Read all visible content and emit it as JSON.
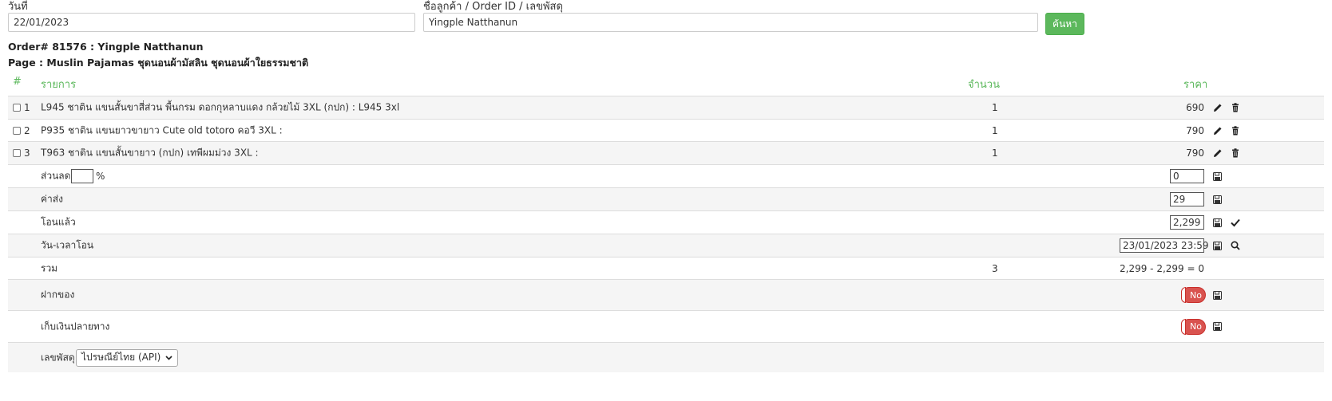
{
  "search": {
    "date_label": "วันที่",
    "date_value": "22/01/2023",
    "customer_label": "ชื่อลูกค้า / Order ID / เลขพัสดุ",
    "customer_value": "Yingple Natthanun",
    "search_button": "ค้นหา"
  },
  "order": {
    "title": "Order# 81576 : Yingple Natthanun",
    "page": "Page : Muslin Pajamas ชุดนอนผ้ามัสลิน ชุดนอนผ้าใยธรรมชาติ"
  },
  "table": {
    "headers": {
      "num": "#",
      "item": "รายการ",
      "qty": "จำนวน",
      "price": "ราคา"
    },
    "items": [
      {
        "no": "1",
        "desc": "L945 ชาติน แขนสั้นขาสี่ส่วน พื้นกรม ดอกกุหลาบแดง กล้วยไม้ 3XL (กปก) : L945 3xl",
        "qty": "1",
        "price": "690"
      },
      {
        "no": "2",
        "desc": "P935 ชาติน แขนยาวขายาว Cute old totoro คอวี 3XL :",
        "qty": "1",
        "price": "790"
      },
      {
        "no": "3",
        "desc": "T963 ชาติน แขนสั้นขายาว (กปก) เทพีผมม่วง 3XL :",
        "qty": "1",
        "price": "790"
      }
    ],
    "discount": {
      "label": "ส่วนลด",
      "percent_value": "",
      "percent_sign": "%",
      "value": "0"
    },
    "shipping": {
      "label": "ค่าส่ง",
      "value": "29"
    },
    "paid": {
      "label": "โอนแล้ว",
      "value": "2,299"
    },
    "transfer_time": {
      "label": "วัน-เวลาโอน",
      "value": "23/01/2023 23:59"
    },
    "total": {
      "label": "รวม",
      "qty": "3",
      "calc": "2,299 - 2,299 = 0"
    },
    "deposit": {
      "label": "ฝากของ",
      "toggle": "No"
    },
    "cod": {
      "label": "เก็บเงินปลายทาง",
      "toggle": "No"
    },
    "tracking": {
      "label": "เลขพัสดุ",
      "select_value": "ไปรษณีย์ไทย (API)"
    }
  },
  "colors": {
    "accent_green": "#5cb85c",
    "toggle_red": "#d9534f"
  }
}
